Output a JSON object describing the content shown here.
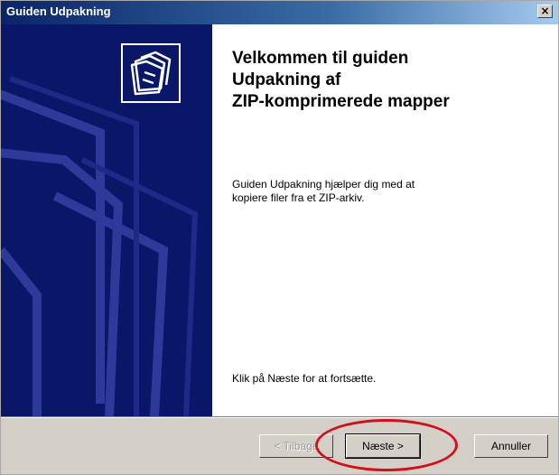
{
  "window": {
    "title": "Guiden Udpakning",
    "close_glyph": "×"
  },
  "wizard": {
    "icon": "zip-folders-icon",
    "heading_lines": [
      "Velkommen til guiden",
      "Udpakning af",
      "ZIP-komprimerede mapper"
    ],
    "description_lines": [
      "Guiden Udpakning hjælper dig med at",
      "kopiere filer fra et ZIP-arkiv."
    ],
    "continue_text": "Klik på Næste for at fortsætte."
  },
  "buttons": {
    "back": "< Tilbage",
    "next": "Næste >",
    "cancel": "Annuller"
  },
  "colors": {
    "sidebar": "#0a1668",
    "titlebar": "#0a246a",
    "highlight": "#d0101c"
  }
}
